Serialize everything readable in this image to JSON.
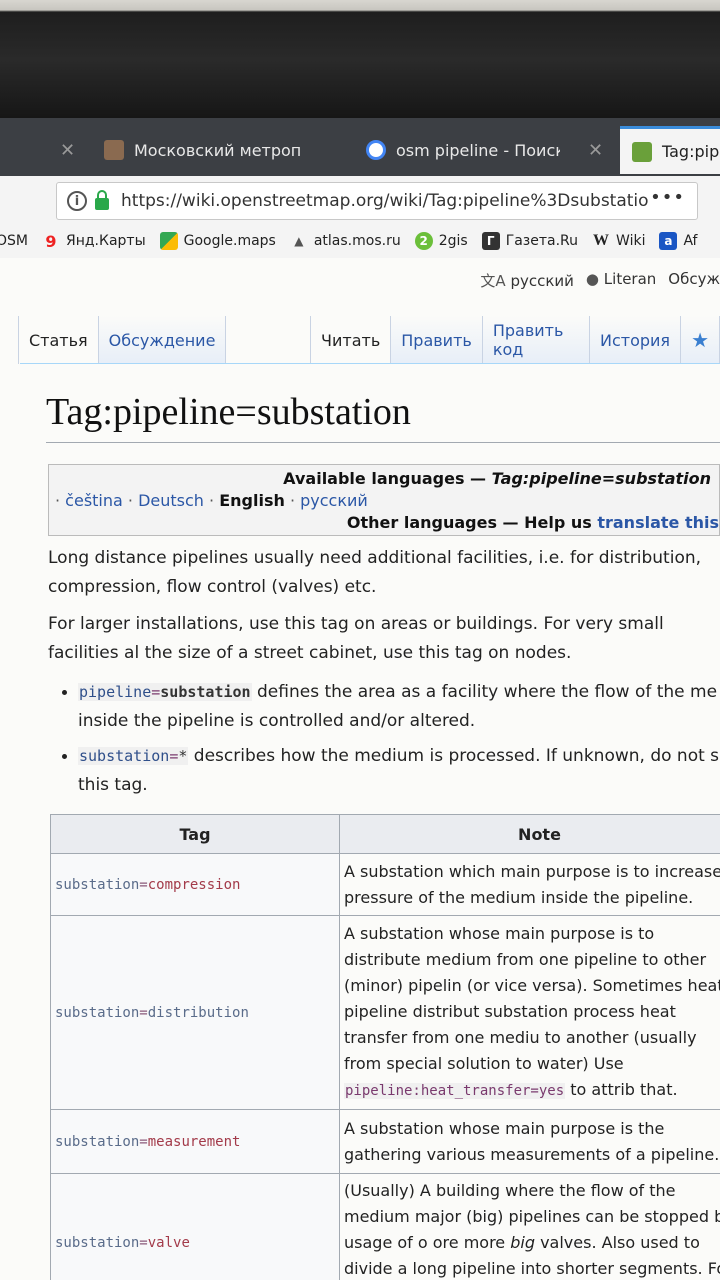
{
  "browser": {
    "tabs": [
      {
        "label": "Московский метропол",
        "active": false
      },
      {
        "label": "osm pipeline - Поиск в",
        "active": false
      },
      {
        "label": "Tag:pipe",
        "active": true
      }
    ],
    "url": "https://wiki.openstreetmap.org/wiki/Tag:pipeline%3Dsubstatio",
    "more_menu": "•••",
    "bookmarks": [
      {
        "label": "OSM"
      },
      {
        "label": "Янд.Карты"
      },
      {
        "label": "Google.maps"
      },
      {
        "label": "atlas.mos.ru"
      },
      {
        "label": "2gis"
      },
      {
        "label": "Газета.Ru"
      },
      {
        "label": "Wiki"
      },
      {
        "label": "Af"
      }
    ]
  },
  "wiki": {
    "personal": {
      "language": "русский",
      "user": "Literan",
      "talk": "Обсуж"
    },
    "namespace_tabs": [
      "Статья",
      "Обсуждение"
    ],
    "view_tabs": [
      "Читать",
      "Править",
      "Править код",
      "История"
    ],
    "title": "Tag:pipeline=substation",
    "langbox": {
      "available": "Available languages — ",
      "available_page": "Tag:pipeline=substation",
      "langs": [
        "čeština",
        "Deutsch",
        "English",
        "русский"
      ],
      "other": "Other languages — Help us ",
      "translate": "translate this"
    },
    "para1": "Long distance pipelines usually need additional facilities, i.e. for distribution, compression, flow control (valves) etc.",
    "para2": "For larger installations, use this tag on areas or buildings. For very small facilities al the size of a street cabinet, use this tag on nodes.",
    "bullet1": {
      "key": "pipeline",
      "value": "substation",
      "text": " defines the area as a facility where the flow of the me inside the pipeline is controlled and/or altered."
    },
    "bullet2": {
      "key": "substation",
      "value": "*",
      "text": " describes how the medium is processed. If unknown, do not sp this tag."
    },
    "table": {
      "headers": [
        "Tag",
        "Note"
      ],
      "rows": [
        {
          "key": "substation",
          "value": "compression",
          "note": "A substation which main purpose is to increase t pressure of the medium inside the pipeline."
        },
        {
          "key": "substation",
          "value": "distribution",
          "note": "A substation whose main purpose is to distribute medium from one pipeline to other (minor) pipelin (or vice versa). Sometimes heat pipeline distribut substation process heat transfer from one mediu to another (usually from special solution to water)",
          "note_code": "pipeline:heat_transfer=yes",
          "note_use": "Use ",
          "note_tail": " to attrib that."
        },
        {
          "key": "substation",
          "value": "measurement",
          "note": "A substation whose main purpose is the gathering various measurements of a pipeline."
        },
        {
          "key": "substation",
          "value": "valve",
          "note_a": "(Usually) A building where the flow of the medium major (big) pipelines can be stopped by usage of o ore more ",
          "note_i": "big",
          "note_b": " valves. Also used to divide a long pipeline into shorter segments. For a single valve,"
        }
      ]
    }
  }
}
